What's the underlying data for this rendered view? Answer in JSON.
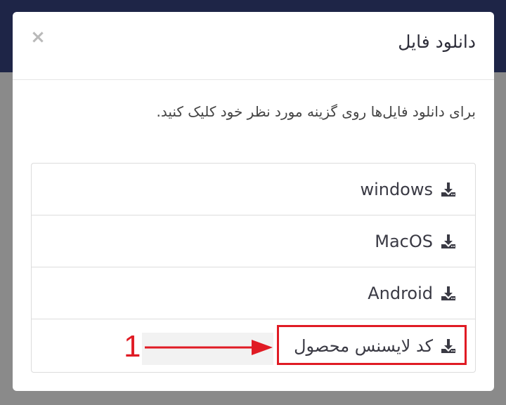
{
  "modal": {
    "title": "دانلود فایل",
    "close_label": "×",
    "instructions": "برای دانلود فایل‌ها روی گزینه مورد نظر خود کلیک کنید.",
    "items": [
      {
        "label": "windows",
        "icon": "download-icon"
      },
      {
        "label": "MacOS",
        "icon": "download-icon"
      },
      {
        "label": "Android",
        "icon": "download-icon"
      },
      {
        "label": "کد لایسنس محصول",
        "icon": "download-icon"
      }
    ]
  },
  "annotation": {
    "number": "1",
    "color": "#e01b24"
  },
  "colors": {
    "header_bg": "#1e2547",
    "overlay": "#8a8a8a",
    "modal_bg": "#ffffff",
    "highlight": "#e01b24"
  }
}
